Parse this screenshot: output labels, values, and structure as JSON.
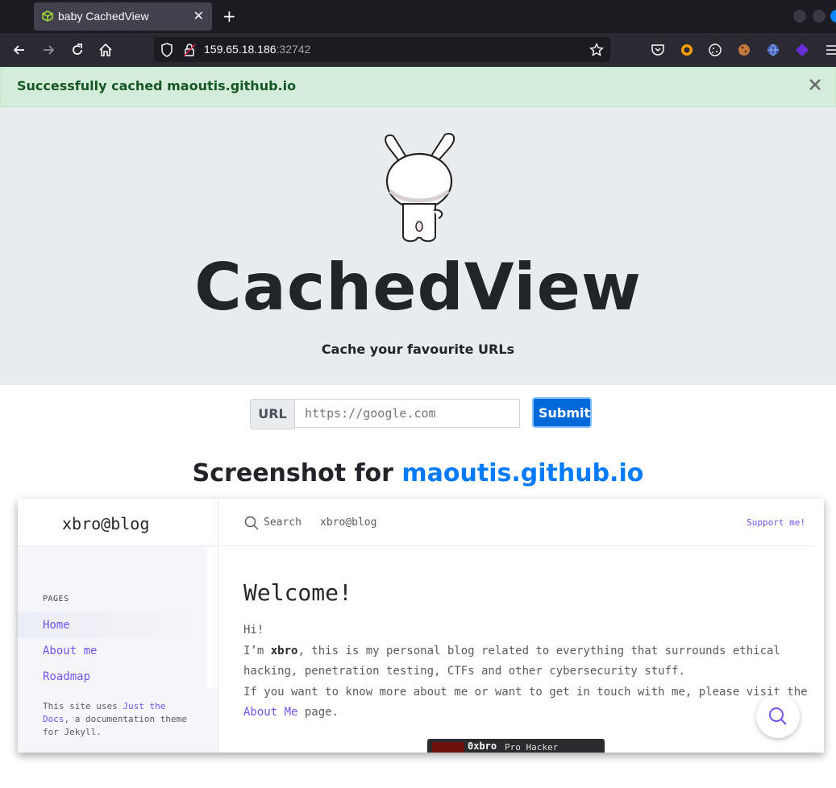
{
  "browser": {
    "tab_title": "baby CachedView",
    "new_tab_symbol": "+",
    "tab_close_symbol": "✕",
    "url_host": "159.65.18.186",
    "url_port": ":32742"
  },
  "alert": {
    "message": "Successfully cached maoutis.github.io",
    "close_symbol": "×"
  },
  "hero": {
    "title": "CachedView",
    "subtitle": "Cache your favourite URLs"
  },
  "form": {
    "label": "URL",
    "placeholder": "https://google.com",
    "submit_label": "Submit"
  },
  "screenshot": {
    "heading_prefix": "Screenshot for ",
    "heading_link": "maoutis.github.io",
    "site": {
      "title": "xbro@blog",
      "search_placeholder": "Search",
      "search_scope": "xbro@blog",
      "support": "Support me!",
      "pages_label": "PAGES",
      "nav": [
        "Home",
        "About me",
        "Roadmap"
      ],
      "footer_prefix": "This site uses ",
      "footer_link": "Just the Docs",
      "footer_suffix": ", a documentation theme for Jekyll.",
      "heading": "Welcome!",
      "greeting": "Hi!",
      "intro_prefix": "I’m ",
      "intro_name": "xbro",
      "intro_rest": ", this is my personal blog related to everything that surrounds ethical hacking, penetration testing, CTFs and other cybersecurity stuff.",
      "contact_text": "If you want to know more about me or want to get in touch with me, please visit the",
      "contact_link": "About Me",
      "contact_suffix": " page.",
      "badge_name": "0xbro",
      "badge_rank": "Pro Hacker"
    }
  },
  "colors": {
    "alert_bg": "#d4edda",
    "alert_text": "#155724",
    "primary": "#007bff",
    "site_accent": "#7253ed"
  },
  "icons": [
    "cube-icon",
    "back-icon",
    "forward-icon",
    "reload-icon",
    "home-icon",
    "shield-icon",
    "lock-icon",
    "star-icon",
    "pocket-icon",
    "search-icon"
  ]
}
